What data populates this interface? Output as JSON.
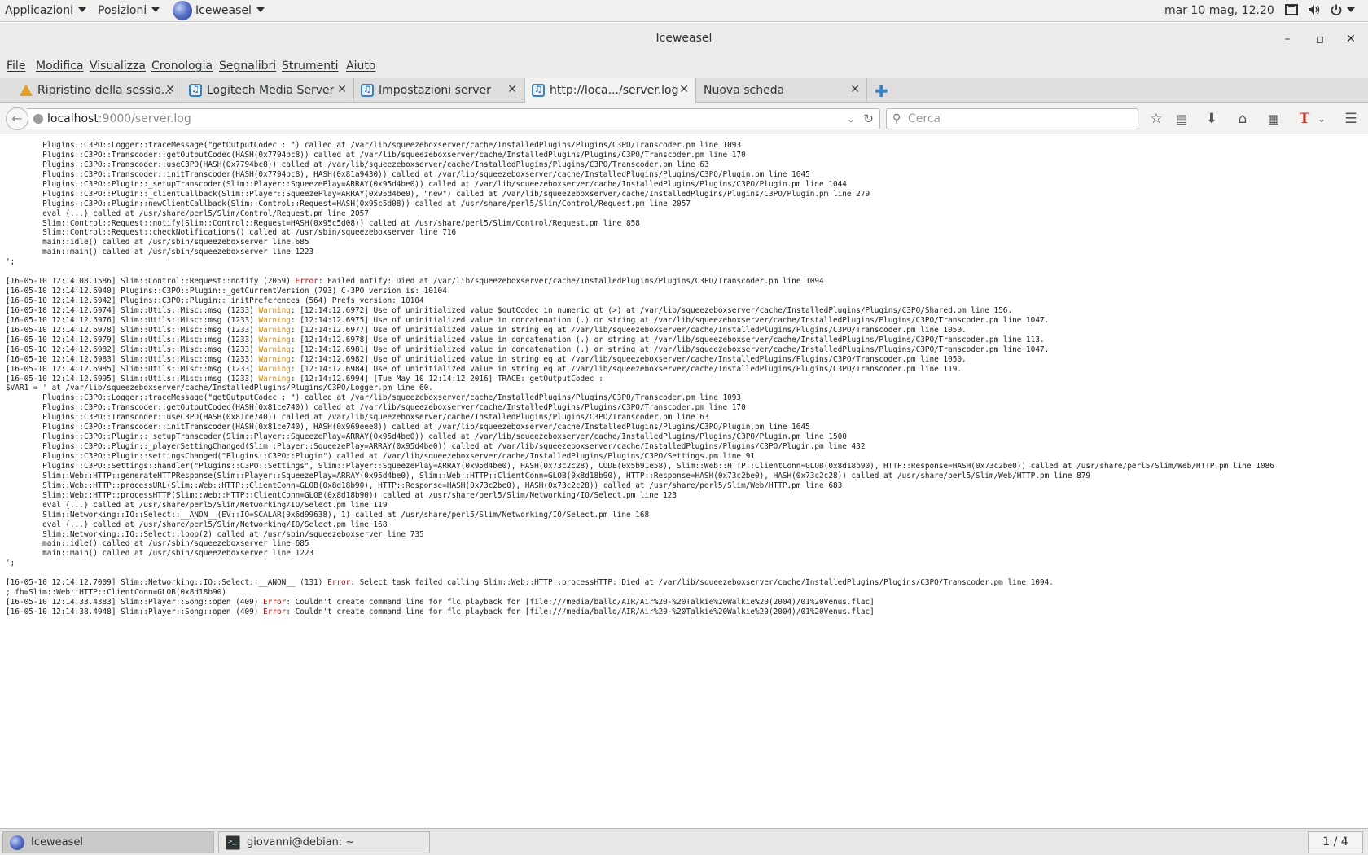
{
  "topbar": {
    "applications": "Applicazioni",
    "places": "Posizioni",
    "app_name": "Iceweasel",
    "clock": "mar 10 mag, 12.20"
  },
  "window": {
    "title": "Iceweasel"
  },
  "menu": [
    "File",
    "Modifica",
    "Visualizza",
    "Cronologia",
    "Segnalibri",
    "Strumenti",
    "Aiuto"
  ],
  "tabs": [
    {
      "label": "Ripristino della sessio...",
      "icon": "warning-icon",
      "active": false
    },
    {
      "label": "Logitech Media Server",
      "icon": "lms-icon",
      "active": false
    },
    {
      "label": "Impostazioni server",
      "icon": "lms-icon",
      "active": false
    },
    {
      "label": "http://loca.../server.log",
      "icon": "lms-icon",
      "active": true
    },
    {
      "label": "Nuova scheda",
      "icon": "",
      "active": false
    }
  ],
  "navbar": {
    "url_host": "localhost",
    "url_rest": ":9000/server.log",
    "search_placeholder": "Cerca"
  },
  "log": [
    [
      "        Plugins::C3PO::Logger::traceMessage(\"getOutputCodec : \") called at /var/lib/squeezeboxserver/cache/InstalledPlugins/Plugins/C3PO/Transcoder.pm line 1093"
    ],
    [
      "        Plugins::C3PO::Transcoder::getOutputCodec(HASH(0x7794bc8)) called at /var/lib/squeezeboxserver/cache/InstalledPlugins/Plugins/C3PO/Transcoder.pm line 170"
    ],
    [
      "        Plugins::C3PO::Transcoder::useC3PO(HASH(0x7794bc8)) called at /var/lib/squeezeboxserver/cache/InstalledPlugins/Plugins/C3PO/Transcoder.pm line 63"
    ],
    [
      "        Plugins::C3PO::Transcoder::initTranscoder(HASH(0x7794bc8), HASH(0x81a9430)) called at /var/lib/squeezeboxserver/cache/InstalledPlugins/Plugins/C3PO/Plugin.pm line 1645"
    ],
    [
      "        Plugins::C3PO::Plugin::_setupTranscoder(Slim::Player::SqueezePlay=ARRAY(0x95d4be0)) called at /var/lib/squeezeboxserver/cache/InstalledPlugins/Plugins/C3PO/Plugin.pm line 1044"
    ],
    [
      "        Plugins::C3PO::Plugin::_clientCallback(Slim::Player::SqueezePlay=ARRAY(0x95d4be0), \"new\") called at /var/lib/squeezeboxserver/cache/InstalledPlugins/Plugins/C3PO/Plugin.pm line 279"
    ],
    [
      "        Plugins::C3PO::Plugin::newClientCallback(Slim::Control::Request=HASH(0x95c5d08)) called at /usr/share/perl5/Slim/Control/Request.pm line 2057"
    ],
    [
      "        eval {...} called at /usr/share/perl5/Slim/Control/Request.pm line 2057"
    ],
    [
      "        Slim::Control::Request::notify(Slim::Control::Request=HASH(0x95c5d08)) called at /usr/share/perl5/Slim/Control/Request.pm line 858"
    ],
    [
      "        Slim::Control::Request::checkNotifications() called at /usr/sbin/squeezeboxserver line 716"
    ],
    [
      "        main::idle() called at /usr/sbin/squeezeboxserver line 685"
    ],
    [
      "        main::main() called at /usr/sbin/squeezeboxserver line 1223"
    ],
    [
      "';"
    ],
    [
      ""
    ],
    [
      "[16-05-10 12:14:08.1586] Slim::Control::Request::notify (2059) ",
      "Error",
      ": Failed notify: Died at /var/lib/squeezeboxserver/cache/InstalledPlugins/Plugins/C3PO/Transcoder.pm line 1094."
    ],
    [
      "[16-05-10 12:14:12.6940] Plugins::C3PO::Plugin::_getCurrentVersion (793) C-3PO version is: 10104"
    ],
    [
      "[16-05-10 12:14:12.6942] Plugins::C3PO::Plugin::_initPreferences (564) Prefs version: 10104"
    ],
    [
      "[16-05-10 12:14:12.6974] Slim::Utils::Misc::msg (1233) ",
      "Warning",
      ": [12:14:12.6972] Use of uninitialized value $outCodec in numeric gt (>) at /var/lib/squeezeboxserver/cache/InstalledPlugins/Plugins/C3PO/Shared.pm line 156."
    ],
    [
      "[16-05-10 12:14:12.6976] Slim::Utils::Misc::msg (1233) ",
      "Warning",
      ": [12:14:12.6975] Use of uninitialized value in concatenation (.) or string at /var/lib/squeezeboxserver/cache/InstalledPlugins/Plugins/C3PO/Transcoder.pm line 1047."
    ],
    [
      "[16-05-10 12:14:12.6978] Slim::Utils::Misc::msg (1233) ",
      "Warning",
      ": [12:14:12.6977] Use of uninitialized value in string eq at /var/lib/squeezeboxserver/cache/InstalledPlugins/Plugins/C3PO/Transcoder.pm line 1050."
    ],
    [
      "[16-05-10 12:14:12.6979] Slim::Utils::Misc::msg (1233) ",
      "Warning",
      ": [12:14:12.6978] Use of uninitialized value in concatenation (.) or string at /var/lib/squeezeboxserver/cache/InstalledPlugins/Plugins/C3PO/Transcoder.pm line 113."
    ],
    [
      "[16-05-10 12:14:12.6982] Slim::Utils::Misc::msg (1233) ",
      "Warning",
      ": [12:14:12.6981] Use of uninitialized value in concatenation (.) or string at /var/lib/squeezeboxserver/cache/InstalledPlugins/Plugins/C3PO/Transcoder.pm line 1047."
    ],
    [
      "[16-05-10 12:14:12.6983] Slim::Utils::Misc::msg (1233) ",
      "Warning",
      ": [12:14:12.6982] Use of uninitialized value in string eq at /var/lib/squeezeboxserver/cache/InstalledPlugins/Plugins/C3PO/Transcoder.pm line 1050."
    ],
    [
      "[16-05-10 12:14:12.6985] Slim::Utils::Misc::msg (1233) ",
      "Warning",
      ": [12:14:12.6984] Use of uninitialized value in string eq at /var/lib/squeezeboxserver/cache/InstalledPlugins/Plugins/C3PO/Transcoder.pm line 119."
    ],
    [
      "[16-05-10 12:14:12.6995] Slim::Utils::Misc::msg (1233) ",
      "Warning",
      ": [12:14:12.6994] [Tue May 10 12:14:12 2016] TRACE: getOutputCodec :"
    ],
    [
      "$VAR1 = ' at /var/lib/squeezeboxserver/cache/InstalledPlugins/Plugins/C3PO/Logger.pm line 60."
    ],
    [
      "        Plugins::C3PO::Logger::traceMessage(\"getOutputCodec : \") called at /var/lib/squeezeboxserver/cache/InstalledPlugins/Plugins/C3PO/Transcoder.pm line 1093"
    ],
    [
      "        Plugins::C3PO::Transcoder::getOutputCodec(HASH(0x81ce740)) called at /var/lib/squeezeboxserver/cache/InstalledPlugins/Plugins/C3PO/Transcoder.pm line 170"
    ],
    [
      "        Plugins::C3PO::Transcoder::useC3PO(HASH(0x81ce740)) called at /var/lib/squeezeboxserver/cache/InstalledPlugins/Plugins/C3PO/Transcoder.pm line 63"
    ],
    [
      "        Plugins::C3PO::Transcoder::initTranscoder(HASH(0x81ce740), HASH(0x969eee8)) called at /var/lib/squeezeboxserver/cache/InstalledPlugins/Plugins/C3PO/Plugin.pm line 1645"
    ],
    [
      "        Plugins::C3PO::Plugin::_setupTranscoder(Slim::Player::SqueezePlay=ARRAY(0x95d4be0)) called at /var/lib/squeezeboxserver/cache/InstalledPlugins/Plugins/C3PO/Plugin.pm line 1500"
    ],
    [
      "        Plugins::C3PO::Plugin::_playerSettingChanged(Slim::Player::SqueezePlay=ARRAY(0x95d4be0)) called at /var/lib/squeezeboxserver/cache/InstalledPlugins/Plugins/C3PO/Plugin.pm line 432"
    ],
    [
      "        Plugins::C3PO::Plugin::settingsChanged(\"Plugins::C3PO::Plugin\") called at /var/lib/squeezeboxserver/cache/InstalledPlugins/Plugins/C3PO/Settings.pm line 91"
    ],
    [
      "        Plugins::C3PO::Settings::handler(\"Plugins::C3PO::Settings\", Slim::Player::SqueezePlay=ARRAY(0x95d4be0), HASH(0x73c2c28), CODE(0x5b91e58), Slim::Web::HTTP::ClientConn=GLOB(0x8d18b90), HTTP::Response=HASH(0x73c2be0)) called at /usr/share/perl5/Slim/Web/HTTP.pm line 1086"
    ],
    [
      "        Slim::Web::HTTP::generateHTTPResponse(Slim::Player::SqueezePlay=ARRAY(0x95d4be0), Slim::Web::HTTP::ClientConn=GLOB(0x8d18b90), HTTP::Response=HASH(0x73c2be0), HASH(0x73c2c28)) called at /usr/share/perl5/Slim/Web/HTTP.pm line 879"
    ],
    [
      "        Slim::Web::HTTP::processURL(Slim::Web::HTTP::ClientConn=GLOB(0x8d18b90), HTTP::Response=HASH(0x73c2be0), HASH(0x73c2c28)) called at /usr/share/perl5/Slim/Web/HTTP.pm line 683"
    ],
    [
      "        Slim::Web::HTTP::processHTTP(Slim::Web::HTTP::ClientConn=GLOB(0x8d18b90)) called at /usr/share/perl5/Slim/Networking/IO/Select.pm line 123"
    ],
    [
      "        eval {...} called at /usr/share/perl5/Slim/Networking/IO/Select.pm line 119"
    ],
    [
      "        Slim::Networking::IO::Select::__ANON__(EV::IO=SCALAR(0x6d99638), 1) called at /usr/share/perl5/Slim/Networking/IO/Select.pm line 168"
    ],
    [
      "        eval {...} called at /usr/share/perl5/Slim/Networking/IO/Select.pm line 168"
    ],
    [
      "        Slim::Networking::IO::Select::loop(2) called at /usr/sbin/squeezeboxserver line 735"
    ],
    [
      "        main::idle() called at /usr/sbin/squeezeboxserver line 685"
    ],
    [
      "        main::main() called at /usr/sbin/squeezeboxserver line 1223"
    ],
    [
      "';"
    ],
    [
      ""
    ],
    [
      "[16-05-10 12:14:12.7009] Slim::Networking::IO::Select::__ANON__ (131) ",
      "Error",
      ": Select task failed calling Slim::Web::HTTP::processHTTP: Died at /var/lib/squeezeboxserver/cache/InstalledPlugins/Plugins/C3PO/Transcoder.pm line 1094."
    ],
    [
      "; fh=Slim::Web::HTTP::ClientConn=GLOB(0x8d18b90)"
    ],
    [
      "[16-05-10 12:14:33.4383] Slim::Player::Song::open (409) ",
      "Error",
      ": Couldn't create command line for flc playback for [file:///media/ballo/AIR/Air%20-%20Talkie%20Walkie%20(2004)/01%20Venus.flac]"
    ],
    [
      "[16-05-10 12:14:38.4948] Slim::Player::Song::open (409) ",
      "Error",
      ": Couldn't create command line for flc playback for [file:///media/ballo/AIR/Air%20-%20Talkie%20Walkie%20(2004)/01%20Venus.flac]"
    ]
  ],
  "taskbar": {
    "items": [
      "Iceweasel",
      "giovanni@debian: ~"
    ],
    "workspace": "1 / 4"
  }
}
